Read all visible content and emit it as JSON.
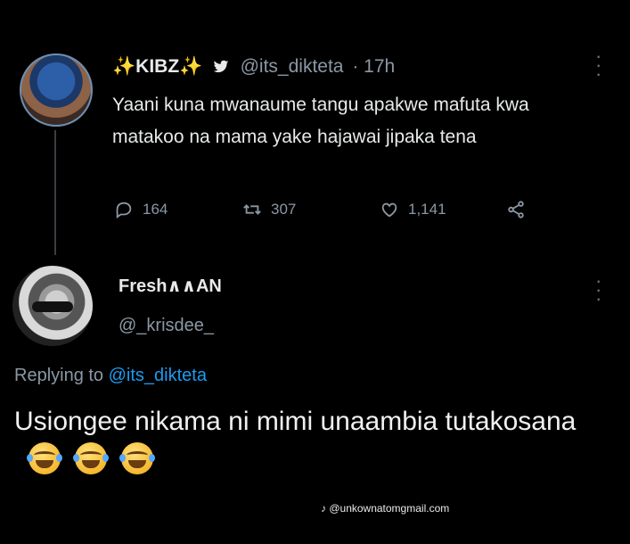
{
  "tweet": {
    "name": "KIBZ",
    "sparkle": "✨",
    "twitter_bird": "🐦",
    "handle": "@its_dikteta",
    "time": "· 17h",
    "text": "Yaani kuna mwanaume tangu apakwe mafuta kwa matakoo na mama yake hajawai jipaka tena",
    "actions": {
      "replies": "164",
      "retweets": "307",
      "likes": "1,141"
    }
  },
  "reply": {
    "name": "Fresh∧∧AN",
    "handle": "@_krisdee_",
    "replying_prefix": "Replying to",
    "replying_to": "@its_dikteta",
    "text": "Usiongee nikama ni mimi unaambia tutakosana"
  },
  "watermark": "♪ @unkownatomgmail.com",
  "colors": {
    "background": "#000000",
    "text": "#e7e9ea",
    "muted": "#8b98a5",
    "mention": "#1d9bf0",
    "sparkle": "#f4c542"
  },
  "icons": [
    "reply-icon",
    "retweet-icon",
    "like-icon",
    "share-icon",
    "more-icon",
    "twitter-bird-icon",
    "laugh-tears-emoji"
  ]
}
